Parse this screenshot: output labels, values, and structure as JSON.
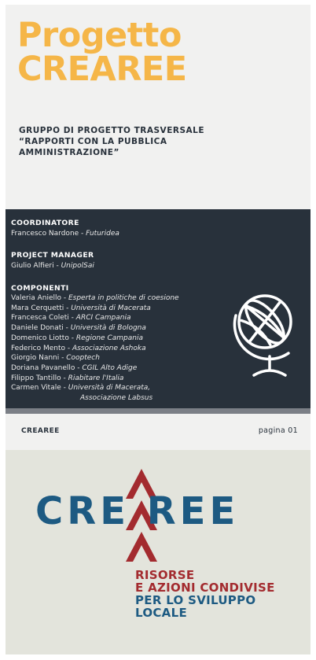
{
  "title": {
    "line1": "Progetto",
    "line2": "CREAREE"
  },
  "subtitle": {
    "line1": "GRUPPO DI PROGETTO TRASVERSALE",
    "line2": "“RAPPORTI CON LA PUBBLICA",
    "line3": "AMMINISTRAZIONE”"
  },
  "coordinatore": {
    "heading": "COORDINATORE",
    "name": "Francesco Nardone - ",
    "aff": "Futuridea"
  },
  "project_manager": {
    "heading": "PROJECT MANAGER",
    "name": "Giulio Alfieri - ",
    "aff": "UnipolSai"
  },
  "componenti": {
    "heading": "COMPONENTI",
    "items": [
      {
        "name": "Valeria Aniello - ",
        "aff": "Esperta in politiche di coesione"
      },
      {
        "name": "Mara Cerquetti - ",
        "aff": "Università di Macerata"
      },
      {
        "name": "Francesca Coleti - ",
        "aff": "ARCI Campania"
      },
      {
        "name": "Daniele Donati - ",
        "aff": "Università di Bologna"
      },
      {
        "name": "Domenico Liotto - ",
        "aff": "Regione Campania"
      },
      {
        "name": "Federico Mento - ",
        "aff": "Associazione Ashoka"
      },
      {
        "name": "Giorgio Nanni - ",
        "aff": "Cooptech"
      },
      {
        "name": "Doriana Pavanello - ",
        "aff": "CGIL Alto Adige"
      },
      {
        "name": "Filippo Tantillo - ",
        "aff": "Riabitare l'Italia"
      },
      {
        "name": "Carmen Vitale - ",
        "aff": "Università di Macerata,"
      }
    ],
    "continuation": "Associazione Labsus"
  },
  "footer": {
    "left": "CREAREE",
    "right": "pagina 01"
  },
  "logo": {
    "word": "CRE  REE",
    "sub_red1": "RISORSE",
    "sub_red2": "E AZIONI CONDIVISE",
    "sub_blue1": "PER LO SVILUPPO",
    "sub_blue2": "LOCALE"
  },
  "colors": {
    "title": "#f5b648",
    "panel": "#28313b",
    "logo_blue": "#1d5a82",
    "logo_red": "#a32b2f"
  },
  "icons": {
    "globe": "globe-icon",
    "logo_mark": "chevron-arrows-icon"
  }
}
